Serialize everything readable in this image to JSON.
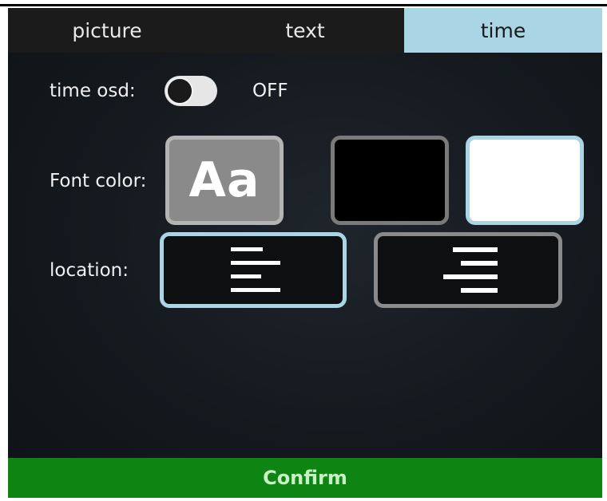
{
  "tabs": [
    {
      "label": "picture",
      "active": false
    },
    {
      "label": "text",
      "active": false
    },
    {
      "label": "time",
      "active": true
    }
  ],
  "time_osd": {
    "label": "time osd:",
    "state": "OFF",
    "enabled": false
  },
  "font_color": {
    "label": "Font color:",
    "sample_text": "Aa",
    "options": [
      {
        "name": "default",
        "color": "#8a8a8a",
        "selected": false
      },
      {
        "name": "black",
        "color": "#000000",
        "selected": false
      },
      {
        "name": "white",
        "color": "#ffffff",
        "selected": true
      }
    ]
  },
  "location": {
    "label": "location:",
    "options": [
      {
        "name": "align-left-icon",
        "selected": true
      },
      {
        "name": "align-right-icon",
        "selected": false
      }
    ]
  },
  "confirm_label": "Confirm",
  "colors": {
    "accent": "#aad5e5",
    "confirm_bg": "#0e8412",
    "confirm_text": "#c9efc4"
  }
}
